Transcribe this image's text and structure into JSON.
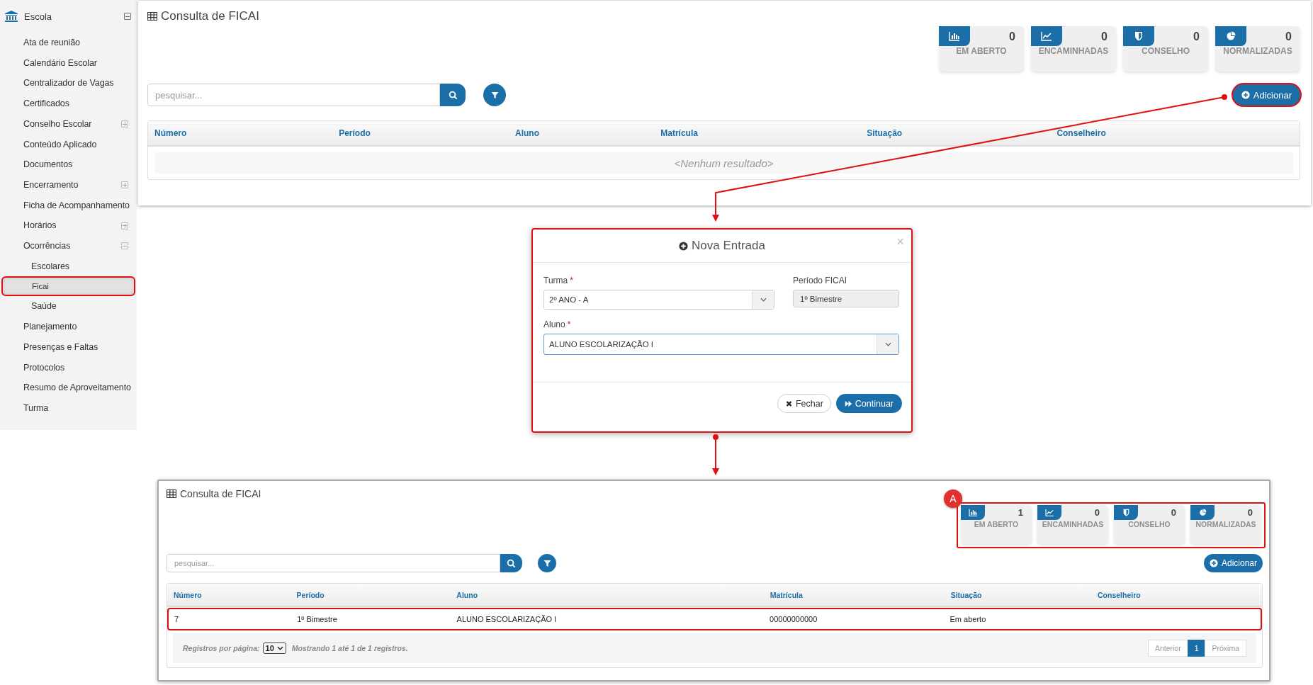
{
  "sidebar": {
    "title": "Escola",
    "expanded": true,
    "items": [
      {
        "label": "Ata de reunião",
        "selected": false
      },
      {
        "label": "Calendário Escolar",
        "selected": false
      },
      {
        "label": "Centralizador de Vagas",
        "selected": false
      },
      {
        "label": "Certificados",
        "selected": false
      },
      {
        "label": "Conselho Escolar",
        "selected": false,
        "expanded": false
      },
      {
        "label": "Conteúdo Aplicado",
        "selected": false
      },
      {
        "label": "Documentos",
        "selected": false
      },
      {
        "label": "Encerramento",
        "selected": false,
        "expanded": false
      },
      {
        "label": "Ficha de Acompanhamento",
        "selected": false
      },
      {
        "label": "Horários",
        "selected": false,
        "expanded": false
      },
      {
        "label": "Ocorrências",
        "selected": false,
        "expanded": true,
        "children": [
          {
            "label": "Escolares",
            "selected": false
          },
          {
            "label": "Ficai",
            "selected": true
          },
          {
            "label": "Saúde",
            "selected": false
          }
        ]
      },
      {
        "label": "Planejamento",
        "selected": false
      },
      {
        "label": "Presenças e Faltas",
        "selected": false
      },
      {
        "label": "Protocolos",
        "selected": false
      },
      {
        "label": "Resumo de Aproveitamento",
        "selected": false
      },
      {
        "label": "Turma",
        "selected": false
      }
    ]
  },
  "top_panel": {
    "title": "Consulta de FICAI",
    "stats": [
      {
        "kind": "open",
        "value": "0",
        "label": "EM ABERTO"
      },
      {
        "kind": "forwarded",
        "value": "0",
        "label": "ENCAMINHADAS"
      },
      {
        "kind": "council",
        "value": "0",
        "label": "CONSELHO"
      },
      {
        "kind": "normalized",
        "value": "0",
        "label": "NORMALIZADAS"
      }
    ],
    "search": {
      "placeholder": "pesquisar..."
    },
    "add_button": {
      "label": "Adicionar",
      "highlighted": true
    },
    "table": {
      "columns": [
        "Número",
        "Período",
        "Aluno",
        "Matrícula",
        "Situação",
        "Conselheiro"
      ],
      "empty_text": "<Nenhum resultado>"
    }
  },
  "dialog": {
    "title": "Nova Entrada",
    "close_symbol": "×",
    "highlighted": true,
    "fields": [
      {
        "kind": "select",
        "label": "Turma",
        "required_mark": "*",
        "value": "2º ANO - A",
        "focused": false
      },
      {
        "kind": "readonly",
        "label": "Período FICAI",
        "value": "1º Bimestre",
        "focused": false
      },
      {
        "kind": "select",
        "label": "Aluno",
        "required_mark": "*",
        "value": "ALUNO ESCOLARIZAÇÃO I",
        "focused": true
      }
    ],
    "buttons": [
      {
        "kind": "close",
        "label": "Fechar"
      },
      {
        "kind": "continue",
        "label": "Continuar"
      }
    ]
  },
  "bottom_panel": {
    "title": "Consulta de FICAI",
    "annotation_badge": "A",
    "stats_highlighted": true,
    "stats": [
      {
        "kind": "open",
        "value": "1",
        "label": "EM ABERTO"
      },
      {
        "kind": "forwarded",
        "value": "0",
        "label": "ENCAMINHADAS"
      },
      {
        "kind": "council",
        "value": "0",
        "label": "CONSELHO"
      },
      {
        "kind": "normalized",
        "value": "0",
        "label": "NORMALIZADAS"
      }
    ],
    "search": {
      "placeholder": "pesquisar..."
    },
    "add_button": {
      "label": "Adicionar",
      "highlighted": false
    },
    "table": {
      "columns": [
        "Número",
        "Período",
        "Aluno",
        "Matrícula",
        "Situação",
        "Conselheiro"
      ],
      "rows": [
        {
          "highlighted": true,
          "cells": [
            "7",
            "1º Bimestre",
            "ALUNO ESCOLARIZAÇÃO I",
            "00000000000",
            "Em aberto"
          ]
        }
      ]
    },
    "pagination": {
      "per_page_label": "Registros por página:",
      "per_page": "10",
      "summary": "Mostrando 1 até 1 de 1 registros.",
      "pages": [
        {
          "label": "Anterior",
          "selected": false,
          "disabled": true
        },
        {
          "label": "1",
          "selected": true,
          "disabled": false
        },
        {
          "label": "Próxima",
          "selected": false,
          "disabled": true
        }
      ]
    }
  }
}
